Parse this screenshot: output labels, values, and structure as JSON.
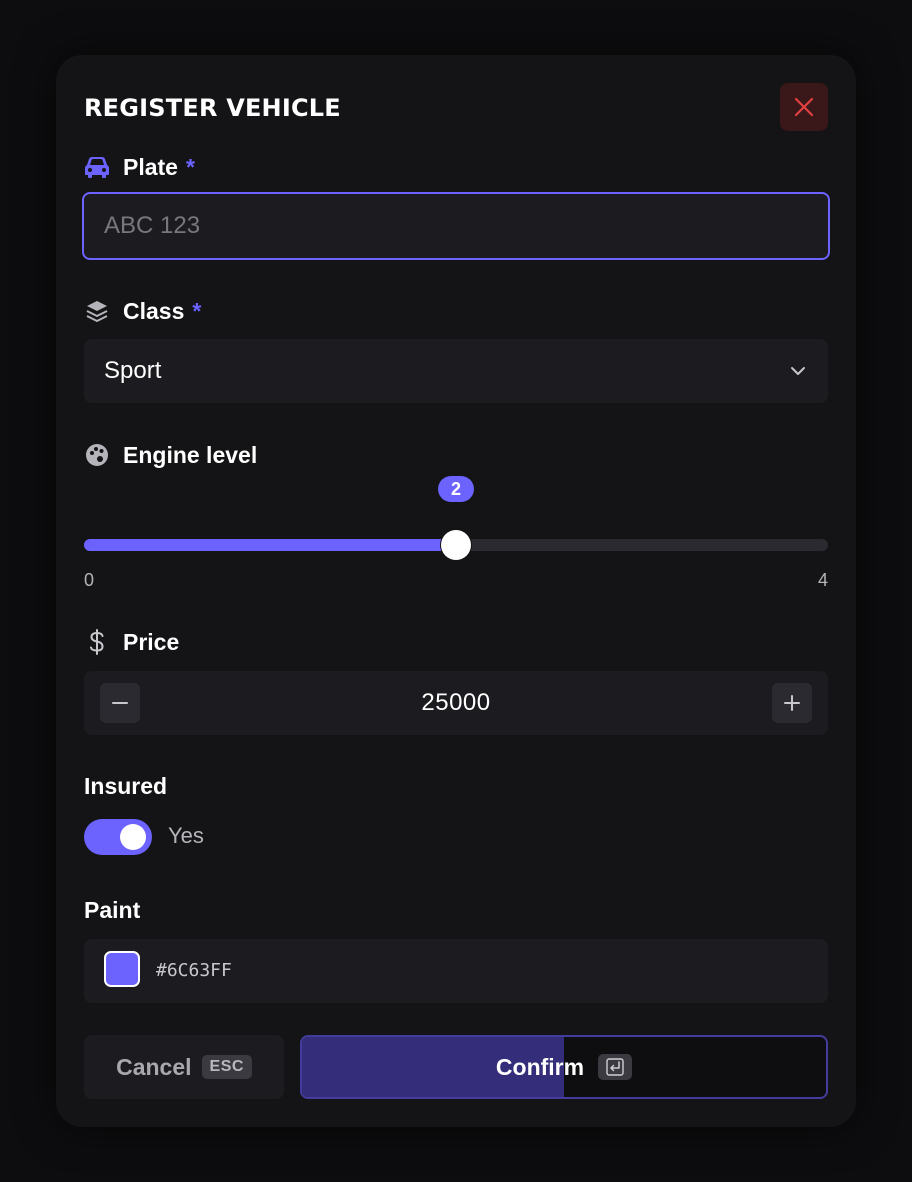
{
  "dialog": {
    "title": "REGISTER VEHICLE"
  },
  "plate": {
    "label": "Plate",
    "required_mark": "*",
    "placeholder": "ABC 123",
    "value": "",
    "icon": "car-icon"
  },
  "vehicle_class": {
    "label": "Class",
    "required_mark": "*",
    "selected": "Sport",
    "icon": "layers-icon"
  },
  "engine": {
    "label": "Engine level",
    "icon": "palette-icon",
    "value": 2,
    "value_label": "2",
    "min": 0,
    "max": 4,
    "min_label": "0",
    "max_label": "4"
  },
  "price": {
    "label": "Price",
    "icon": "dollar-icon",
    "value": "25000"
  },
  "insured": {
    "label": "Insured",
    "on": true,
    "state_label": "Yes"
  },
  "paint": {
    "label": "Paint",
    "value": "#6C63FF",
    "display_value": "#6C63FF"
  },
  "actions": {
    "cancel_label": "Cancel",
    "cancel_key": "ESC",
    "confirm_label": "Confirm",
    "confirm_progress": 0.5
  },
  "colors": {
    "accent": "#6c63ff",
    "close_icon": "#e0413f"
  }
}
